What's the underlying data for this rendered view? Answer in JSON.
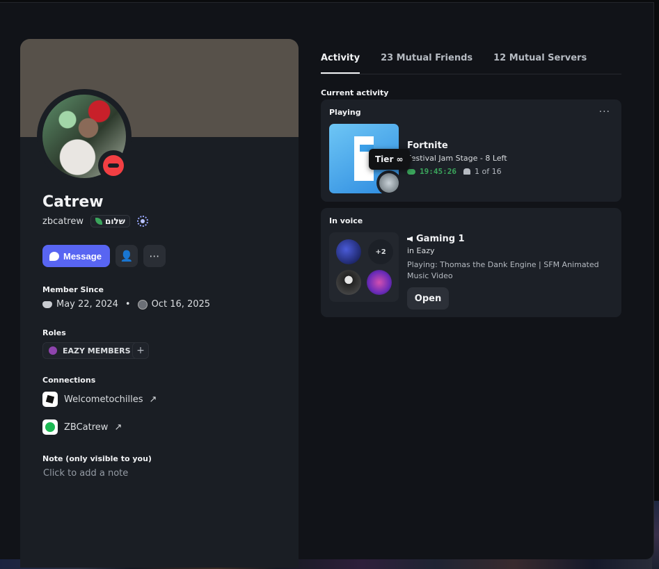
{
  "profile": {
    "display_name": "Catrew",
    "username": "zbcatrew",
    "server_tag": "שלום",
    "message_label": "Message"
  },
  "member_since": {
    "label": "Member Since",
    "discord_date": "May 22, 2024",
    "separator": "•",
    "server_date": "Oct 16, 2025"
  },
  "roles": {
    "label": "Roles",
    "items": [
      {
        "name": "EAZY MEMBERS",
        "color": "#8e44ad"
      }
    ],
    "add_label": "+"
  },
  "connections": {
    "label": "Connections",
    "items": [
      {
        "service_icon": "roblox-icon",
        "name": "Welcometochilles",
        "arrow": "↗"
      },
      {
        "service_icon": "spotify-icon",
        "name": "ZBCatrew",
        "arrow": "↗"
      }
    ]
  },
  "note": {
    "label": "Note (only visible to you)",
    "placeholder": "Click to add a note"
  },
  "tabs": [
    {
      "label": "Activity",
      "active": true
    },
    {
      "label": "23 Mutual Friends",
      "active": false
    },
    {
      "label": "12 Mutual Servers",
      "active": false
    }
  ],
  "activity": {
    "section_label": "Current activity",
    "playing_label": "Playing",
    "more": "···",
    "game_name": "Fortnite",
    "game_detail": "Festival Jam Stage - 8 Left",
    "elapsed": "19:45:26",
    "party": "1 of 16",
    "tooltip": "Tier ∞"
  },
  "voice": {
    "label": "In voice",
    "channel": "Gaming 1",
    "server": "in Eazy",
    "playing": "Playing: Thomas the Dank Engine | SFM Animated Music Video",
    "more_count": "+2",
    "open_label": "Open"
  },
  "colors": {
    "accent": "#5865f2",
    "dnd_status": "#f23f43",
    "timer_green": "#3ba55c"
  }
}
